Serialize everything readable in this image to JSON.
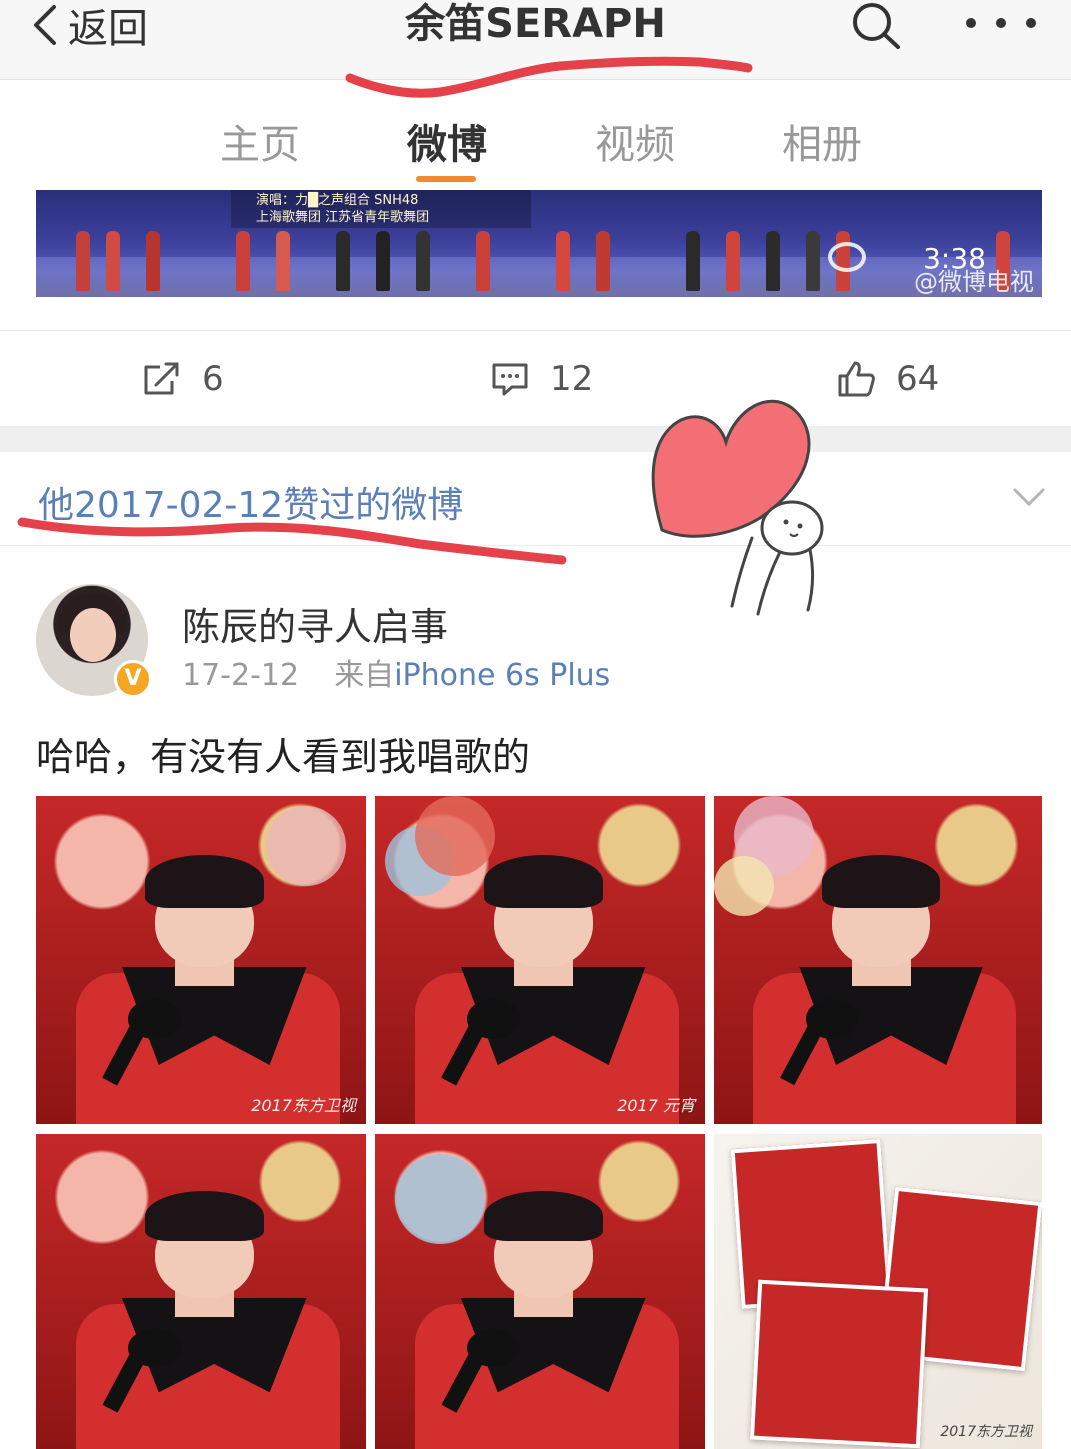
{
  "nav": {
    "back_label": "返回",
    "title": "余笛SERAPH"
  },
  "tabs": [
    {
      "label": "主页",
      "active": false
    },
    {
      "label": "微博",
      "active": true
    },
    {
      "label": "视频",
      "active": false
    },
    {
      "label": "相册",
      "active": false
    }
  ],
  "video": {
    "caption_line1": "演唱：力█之声组合 SNH48",
    "caption_line2": "上海歌舞团 江苏省青年歌舞团",
    "duration": "3:38",
    "watermark": "@微博电视"
  },
  "actions": {
    "repost_count": "6",
    "comment_count": "12",
    "like_count": "64"
  },
  "liked_header": {
    "text": "他2017-02-12赞过的微博"
  },
  "post": {
    "author": "陈辰的寻人启事",
    "date": "17-2-12",
    "source_prefix": "来自",
    "source": "iPhone 6s Plus",
    "text": "哈哈，有没有人看到我唱歌的",
    "verified_badge": "V",
    "photo_stamps": [
      "2017东方卫视",
      "2017 元宵",
      "2017东方卫视"
    ]
  },
  "colors": {
    "accent_orange": "#f08a2c",
    "link_blue": "#5b7fb8",
    "annotation_red": "#e5414a"
  }
}
